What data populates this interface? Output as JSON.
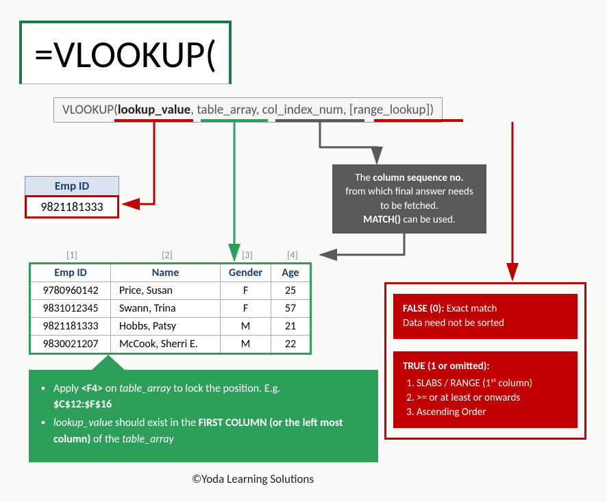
{
  "formula": "=VLOOKUP(",
  "syntax": {
    "func": "VLOOKUP(",
    "arg1": "lookup_value",
    "sep1": ", ",
    "arg2": "table_array",
    "sep2": ", ",
    "arg3": "col_index_num",
    "sep3": ", ",
    "arg4": "[range_lookup]",
    "close": ")"
  },
  "empid": {
    "label": "Emp ID",
    "value": "9821181333"
  },
  "col_markers": [
    "[1]",
    "[2]",
    "[3]",
    "[4]"
  ],
  "table": {
    "headers": [
      "Emp ID",
      "Name",
      "Gender",
      "Age"
    ],
    "rows": [
      [
        "9780960142",
        "Price, Susan",
        "F",
        "25"
      ],
      [
        "9831012345",
        "Swann, Trina",
        "F",
        "57"
      ],
      [
        "9821181333",
        "Hobbs, Patsy",
        "M",
        "21"
      ],
      [
        "9830021207",
        "McCook, Sherri E.",
        "M",
        "22"
      ]
    ]
  },
  "grey_callout": {
    "line1a": "The ",
    "line1b": "column sequence no.",
    "line2": "from which final answer needs to be fetched.",
    "line3a": "MATCH()",
    "line3b": " can be used."
  },
  "green_callout": {
    "b1a": "Apply ",
    "b1b": "<F4>",
    "b1c": " on ",
    "b1d": "table_array",
    "b1e": " to lock the position. E.g. ",
    "b1f": "$C$12:$F$16",
    "b2a": "lookup_value",
    "b2b": " should exist in the ",
    "b2c": "FIRST COLUMN (or the left most column)",
    "b2d": " of the ",
    "b2e": "table_array"
  },
  "red_false": {
    "title": "FALSE (0):",
    "text1": " Exact match",
    "text2": "Data need not be sorted"
  },
  "red_true": {
    "title": "TRUE (1 or omitted):",
    "items": [
      "SLABS / RANGE (1ˢᵗ column)",
      ">= or at least or onwards",
      "Ascending Order"
    ]
  },
  "copyright": "©Yoda Learning Solutions"
}
